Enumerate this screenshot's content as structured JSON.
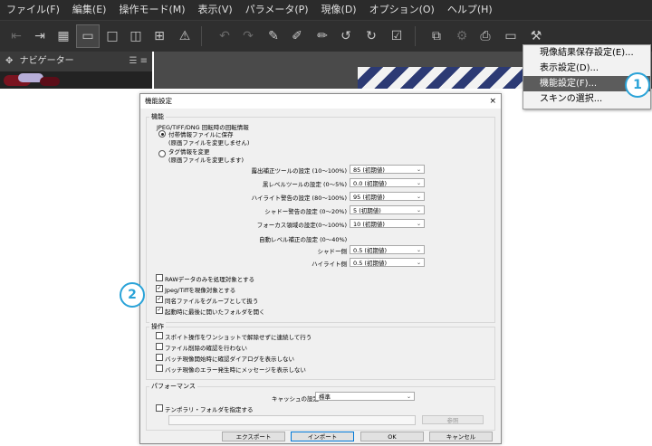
{
  "menubar": [
    "ファイル(F)",
    "編集(E)",
    "操作モード(M)",
    "表示(V)",
    "パラメータ(P)",
    "現像(D)",
    "オプション(O)",
    "ヘルプ(H)"
  ],
  "navigator": {
    "title": "ナビゲーター",
    "icons": "☰ ≡"
  },
  "option_menu": {
    "items": [
      "現像結果保存設定(E)...",
      "表示設定(D)...",
      "機能設定(F)...",
      "スキンの選択..."
    ],
    "highlighted_index": 2
  },
  "callouts": [
    "1",
    "2"
  ],
  "dialog": {
    "title": "機能設定",
    "close": "×",
    "feature_group": {
      "label": "機能",
      "rotation_heading": "JPEG/TIFF/DNG 回転時の回転情報",
      "radio1_line1": "付帯情報ファイルに保存",
      "radio1_line2": "(原画ファイルを変更しません)",
      "radio2_line1": "タグ情報を変更",
      "radio2_line2": "(原画ファイルを変更します)",
      "settings": [
        {
          "label": "露出補正ツールの設定 (10〜100%)",
          "value": "85 (初期値)"
        },
        {
          "label": "黒レベルツールの設定 (0〜5%)",
          "value": "0.0 (初期値)"
        },
        {
          "label": "ハイライト警告の設定 (80〜100%)",
          "value": "95 (初期値)"
        },
        {
          "label": "シャドー警告の設定 (0〜20%)",
          "value": "5 (初期値)"
        },
        {
          "label": "フォーカス領域の設定(0〜100%)",
          "value": "10 (初期値)"
        }
      ],
      "auto_level_heading": "自動レベル補正の設定 (0〜40%)",
      "auto_level": [
        {
          "label": "シャドー側",
          "value": "0.5 (初期値)"
        },
        {
          "label": "ハイライト側",
          "value": "0.5 (初期値)"
        }
      ],
      "checkboxes": [
        {
          "label": "RAWデータのみを処理対象とする",
          "checked": false
        },
        {
          "label": "Jpeg/Tiffを現像対象とする",
          "checked": true
        },
        {
          "label": "同名ファイルをグループとして扱う",
          "checked": true
        },
        {
          "label": "起動時に最後に開いたフォルダを開く",
          "checked": true
        }
      ]
    },
    "operation_group": {
      "label": "操作",
      "checkboxes": [
        {
          "label": "スポイト操作をワンショットで解除せずに連続して行う",
          "checked": false
        },
        {
          "label": "ファイル削除の確認を行わない",
          "checked": false
        },
        {
          "label": "バッチ現像開始時に確認ダイアログを表示しない",
          "checked": false
        },
        {
          "label": "バッチ現像のエラー発生時にメッセージを表示しない",
          "checked": false
        }
      ]
    },
    "performance_group": {
      "label": "パフォーマンス",
      "cache_label": "キャッシュの設定",
      "cache_value": "標準",
      "temp_folder_label": "テンポラリ・フォルダを指定する",
      "browse_label": "参照"
    },
    "buttons": {
      "export": "エクスポート",
      "import": "インポート",
      "ok": "OK",
      "cancel": "キャンセル"
    }
  }
}
